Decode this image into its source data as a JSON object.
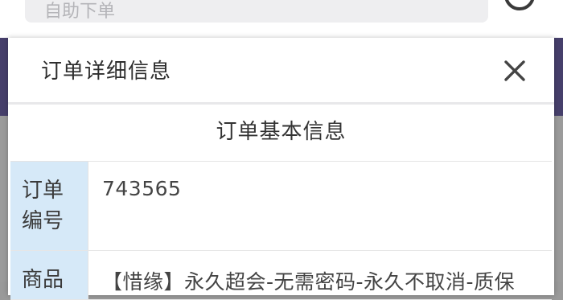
{
  "background": {
    "search_placeholder": "自助下单"
  },
  "modal": {
    "title": "订单详细信息",
    "section_title": "订单基本信息",
    "rows": [
      {
        "label": "订单编号",
        "value": "743565"
      },
      {
        "label": "商品",
        "value": "【惜缘】永久超会-无需密码-永久不取消-质保"
      }
    ]
  },
  "colors": {
    "header_band": "#463f6b",
    "label_background": "#d6e9f8",
    "overlay": "#9a9a9a"
  },
  "icons": {
    "close": "close-icon",
    "refresh": "refresh-icon"
  }
}
